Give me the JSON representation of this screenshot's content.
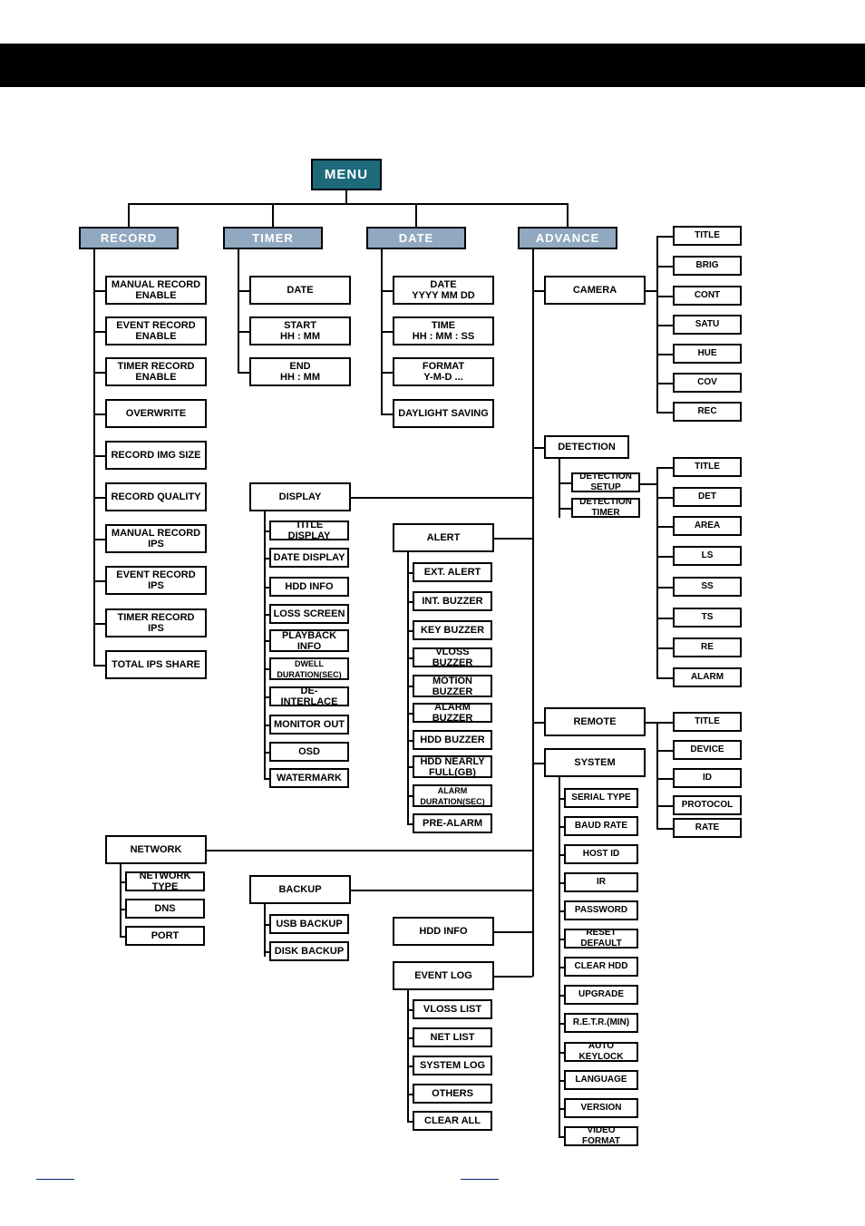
{
  "menu_root": "MENU",
  "headers": {
    "record": "RECORD",
    "timer": "TIMER",
    "date": "DATE",
    "advance": "ADVANCE"
  },
  "record_col": [
    "MANUAL RECORD ENABLE",
    "EVENT RECORD ENABLE",
    "TIMER RECORD ENABLE",
    "OVERWRITE",
    "RECORD IMG SIZE",
    "RECORD QUALITY",
    "MANUAL RECORD IPS",
    "EVENT RECORD IPS",
    "TIMER RECORD IPS",
    "TOTAL IPS SHARE"
  ],
  "timer_col": {
    "date": {
      "line1": "DATE"
    },
    "start": {
      "line1": "START",
      "line2": "HH : MM"
    },
    "end": {
      "line1": "END",
      "line2": "HH : MM"
    }
  },
  "date_col": {
    "date": {
      "line1": "DATE",
      "line2": "YYYY MM DD"
    },
    "time": {
      "line1": "TIME",
      "line2": "HH : MM : SS"
    },
    "format": {
      "line1": "FORMAT",
      "line2": "Y-M-D ..."
    },
    "daylight": {
      "line1": "DAYLIGHT SAVING"
    }
  },
  "advance_col": {
    "camera": "CAMERA",
    "detection": "DETECTION",
    "display": "DISPLAY",
    "alert": "ALERT",
    "remote": "REMOTE",
    "system": "SYSTEM",
    "network": "NETWORK",
    "backup": "BACKUP",
    "hdd_info": "HDD INFO",
    "event_log": "EVENT LOG"
  },
  "detection_sub": [
    "DETECTION SETUP",
    "DETECTION TIMER"
  ],
  "display_sub": [
    "TITLE DISPLAY",
    "DATE DISPLAY",
    "HDD INFO",
    "LOSS SCREEN",
    "PLAYBACK INFO",
    "DWELL DURATION(SEC)",
    "DE-INTERLACE",
    "MONITOR OUT",
    "OSD",
    "WATERMARK"
  ],
  "alert_sub": [
    "EXT. ALERT",
    "INT. BUZZER",
    "KEY BUZZER",
    "VLOSS BUZZER",
    "MOTION BUZZER",
    "ALARM BUZZER",
    "HDD BUZZER",
    "HDD NEARLY FULL(GB)",
    "ALARM DURATION(SEC)",
    "PRE-ALARM"
  ],
  "system_sub": [
    "SERIAL TYPE",
    "BAUD RATE",
    "HOST ID",
    "IR",
    "PASSWORD",
    "RESET DEFAULT",
    "CLEAR HDD",
    "UPGRADE",
    "R.E.T.R.(MIN)",
    "AUTO KEYLOCK",
    "LANGUAGE",
    "VERSION",
    "VIDEO FORMAT"
  ],
  "network_sub": [
    "NETWORK TYPE",
    "DNS",
    "PORT"
  ],
  "backup_sub": [
    "USB BACKUP",
    "DISK BACKUP"
  ],
  "eventlog_sub": [
    "VLOSS LIST",
    "NET LIST",
    "SYSTEM LOG",
    "OTHERS",
    "CLEAR ALL"
  ],
  "camera_right": [
    "TITLE",
    "BRIG",
    "CONT",
    "SATU",
    "HUE",
    "COV",
    "REC"
  ],
  "detection_right": [
    "TITLE",
    "DET",
    "AREA",
    "LS",
    "SS",
    "TS",
    "RE",
    "ALARM"
  ],
  "remote_right": [
    "TITLE",
    "DEVICE",
    "ID",
    "PROTOCOL",
    "RATE"
  ]
}
